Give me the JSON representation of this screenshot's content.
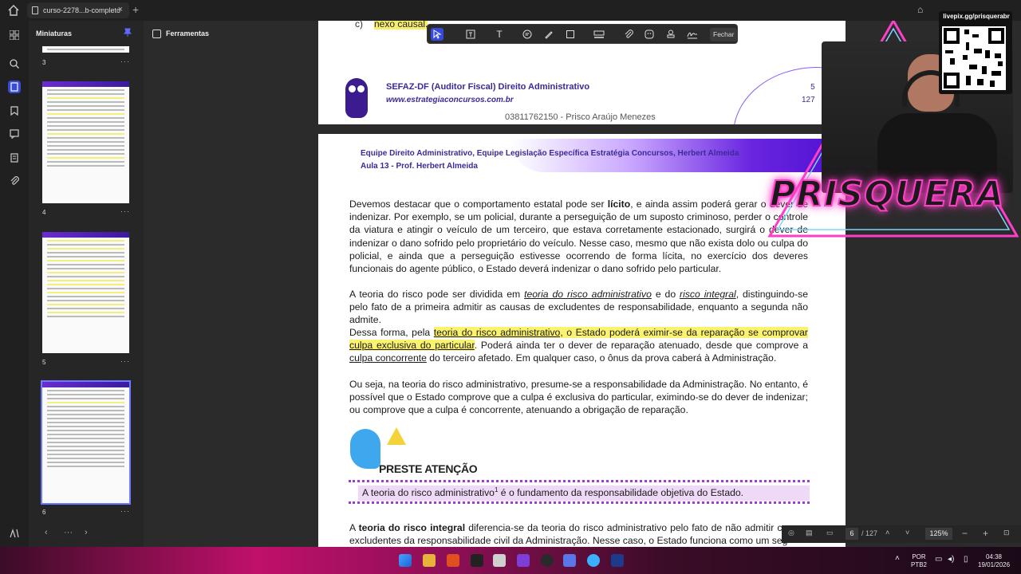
{
  "tab": {
    "title": "curso-2278...b-completo",
    "close": "×",
    "newtab": "+"
  },
  "panel": {
    "title": "Miniaturas",
    "pages": [
      {
        "num": "3"
      },
      {
        "num": "4"
      },
      {
        "num": "5"
      },
      {
        "num": "6"
      }
    ],
    "more": "···"
  },
  "tools": {
    "label": "Ferramentas"
  },
  "annotation_toolbar": {
    "close": "Fechar"
  },
  "page_prev": {
    "item_label": "c)",
    "item_text": "nexo causal.",
    "header_title": "SEFAZ-DF (Auditor Fiscal) Direito Administrativo",
    "header_site": "www.estrategiaconcursos.com.br",
    "page_current": "5",
    "page_total": "127",
    "cpf": "03811762150 - Prisco Araújo Menezes"
  },
  "page": {
    "header_1": "Equipe Direito Administrativo, Equipe Legislação Específica Estratégia Concursos, Herbert Almeida",
    "header_2": "Aula 13 - Prof. Herbert Almeida",
    "p1": {
      "a": "Devemos destacar que o comportamento estatal pode ser ",
      "b": "lícito",
      "c": ", e ainda assim poderá gerar o dever de indenizar. Por exemplo, se um policial, durante a perseguição de um suposto criminoso, perder o controle da viatura e atingir o veículo de um terceiro, que estava corretamente estacionado, surgirá o dever de indenizar o dano sofrido pelo proprietário do veículo. Nesse caso, mesmo que não exista dolo ou culpa do policial, e ainda que a perseguição estivesse ocorrendo de forma lícita, no exercício dos deveres funcionais do agente público, o Estado deverá indenizar o dano sofrido pelo particular."
    },
    "p2": {
      "a": "A teoria do risco pode ser dividida em ",
      "b": "teoria do risco administrativo",
      "c": " e do ",
      "d": "risco integral",
      "e": ", distinguindo-se pelo fato de a primeira admitir as causas de excludentes de responsabilidade, enquanto a segunda não admite."
    },
    "p3": {
      "a": "Dessa forma, pela ",
      "b": "teoria do risco administrativo",
      "c": ", o Estado poderá eximir-se da reparação se comprovar ",
      "d": "culpa exclusiva do particular",
      "e": ". Poderá ainda ter o dever de reparação atenuado, desde que comprove a ",
      "f": "culpa concorrente",
      "g": " do terceiro afetado. Em qualquer caso, o ônus da prova caberá à Administração."
    },
    "p4": "Ou seja, na teoria do risco administrativo, presume-se a responsabilidade da Administração. No entanto, é possível que o Estado comprove que a culpa é exclusiva do particular, eximindo-se do dever de indenizar; ou comprove que a culpa é concorrente, atenuando a obrigação de reparação.",
    "attention_title": "PRESTE ATENÇÃO",
    "attention_a": "A teoria do risco administrativo",
    "attention_sup": "1",
    "attention_b": " é o fundamento da responsabilidade objetiva do Estado.",
    "p5": {
      "a": "A ",
      "b": "teoria do risco integral",
      "c": " diferencia-se da teoria do risco administrativo pelo fato de não admitir causas excludentes da responsabilidade civil da Administração. Nesse caso, o Estado funciona como um seg"
    }
  },
  "pager": {
    "current": "6",
    "total": "/ 127",
    "zoom": "125%"
  },
  "overlay": {
    "brand": "PRISQUERA",
    "qr_label": "livepix.gg/prisquerabr"
  },
  "taskbar": {
    "lang_1": "POR",
    "lang_2": "PTB2",
    "time": "04:38",
    "date": "19/01/2026"
  },
  "colors": {
    "accent": "#3a4ad8",
    "highlight": "#fbf36e",
    "header_text": "#3b2a98",
    "attention_fill": "#eed9f7"
  }
}
